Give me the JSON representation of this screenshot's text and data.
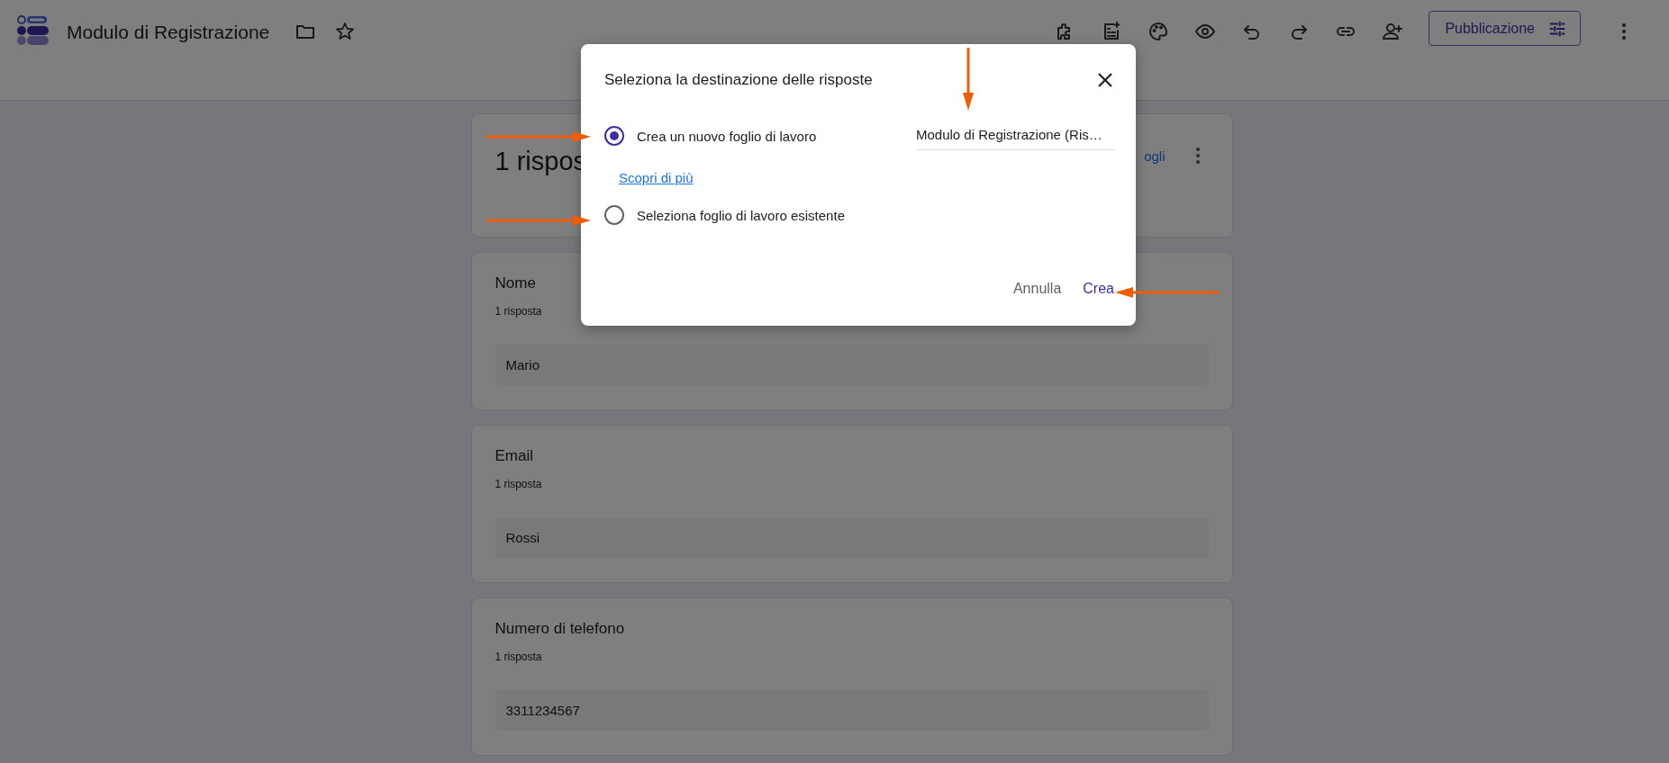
{
  "header": {
    "title": "Modulo di Registrazione",
    "publish_button": "Pubblicazione"
  },
  "summary": {
    "heading": "1 rispos",
    "link": "ogli"
  },
  "questions": [
    {
      "title": "Nome",
      "count": "1 risposta",
      "answer": "Mario"
    },
    {
      "title": "Email",
      "count": "1 risposta",
      "answer": "Rossi"
    },
    {
      "title": "Numero di telefono",
      "count": "1 risposta",
      "answer": "3311234567"
    }
  ],
  "dialog": {
    "title": "Seleziona la destinazione delle risposte",
    "sheet_name": "Modulo di Registrazione (Ris…",
    "options": [
      {
        "label": "Crea un nuovo foglio di lavoro",
        "selected": true,
        "link": "Scopri di più"
      },
      {
        "label": "Seleziona foglio di lavoro esistente",
        "selected": false
      }
    ],
    "buttons": [
      {
        "label": "Annulla",
        "kind": "cancel"
      },
      {
        "label": "Crea",
        "kind": "confirm"
      }
    ]
  }
}
